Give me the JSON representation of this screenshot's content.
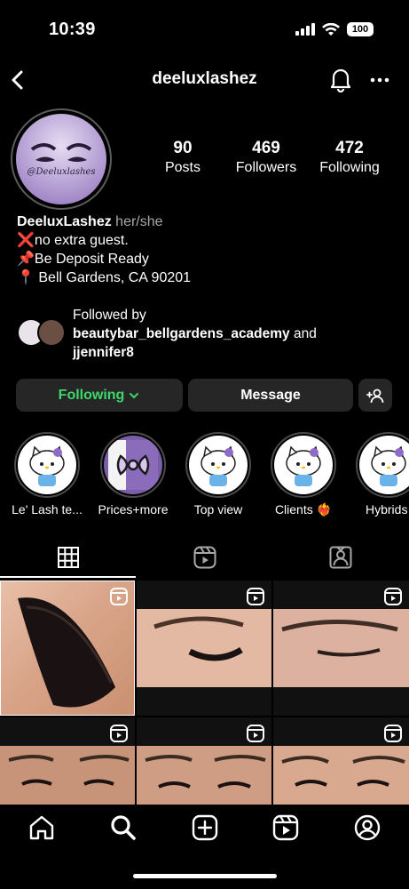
{
  "status": {
    "time": "10:39",
    "battery": "100"
  },
  "header": {
    "username": "deeluxlashez"
  },
  "profile": {
    "avatar_text": "@Deeluxlashes",
    "stats": [
      {
        "value": "90",
        "label": "Posts"
      },
      {
        "value": "469",
        "label": "Followers"
      },
      {
        "value": "472",
        "label": "Following"
      }
    ],
    "bio": {
      "name": "DeeluxLashez",
      "pronouns": "her/she",
      "lines": [
        "❌no extra guest.",
        "📌Be Deposit Ready",
        "📍 Bell Gardens, CA 90201"
      ]
    },
    "followed_by": {
      "prefix": "Followed by",
      "user1": "beautybar_bellgardens_academy",
      "conj": " and",
      "user2": "jjennifer8"
    }
  },
  "actions": {
    "following": "Following",
    "message": "Message"
  },
  "highlights": [
    {
      "label": "Le' Lash te..."
    },
    {
      "label": "Prices+more"
    },
    {
      "label": "Top view"
    },
    {
      "label": "Clients ❤️‍🔥"
    },
    {
      "label": "Hybrids"
    }
  ],
  "colors": {
    "accent_green": "#3dd76b",
    "button_bg": "#262626",
    "background": "#000000"
  }
}
